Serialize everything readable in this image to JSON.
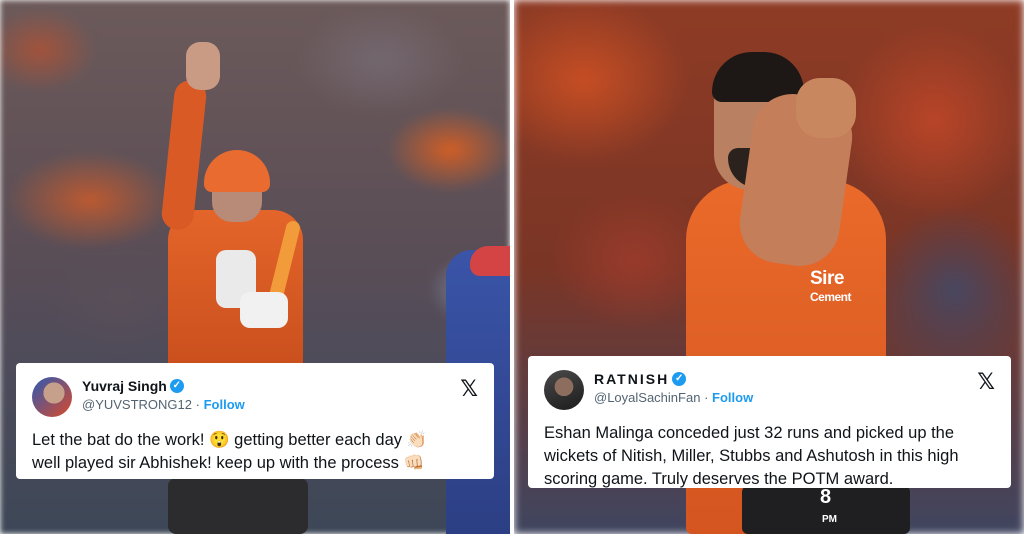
{
  "tweets": [
    {
      "display_name": "Yuvraj Singh",
      "handle": "@YUVSTRONG12",
      "separator": "·",
      "follow_label": "Follow",
      "verified_glyph": "✓",
      "avatar_icon": "profile-photo",
      "x_logo": "𝕏",
      "text_line1": "Let the bat do the work! 😲 getting better each day 👏🏻",
      "text_line2": "well played sir Abhishek! keep up with the process 👊🏻"
    },
    {
      "display_name": "RATNISH",
      "handle": "@LoyalSachinFan",
      "separator": "·",
      "follow_label": "Follow",
      "verified_glyph": "✓",
      "avatar_icon": "profile-photo",
      "x_logo": "𝕏",
      "text_line1": "Eshan Malinga conceded just 32 runs and picked up the",
      "text_line2": "wickets of Nitish, Miller, Stubbs and Ashutosh in this high",
      "text_line3": "scoring game. Truly deserves the POTM award."
    }
  ],
  "photo_right": {
    "jersey_sponsor_line1": "Sire",
    "jersey_sponsor_line2": "Cement",
    "jersey_number": "8",
    "jersey_initials": "PM"
  },
  "colors": {
    "team_orange": "#e4652a",
    "verified_blue": "#1d9bf0",
    "follow_blue": "#1d9bf0",
    "text_primary": "#0f1419",
    "text_secondary": "#536471"
  }
}
